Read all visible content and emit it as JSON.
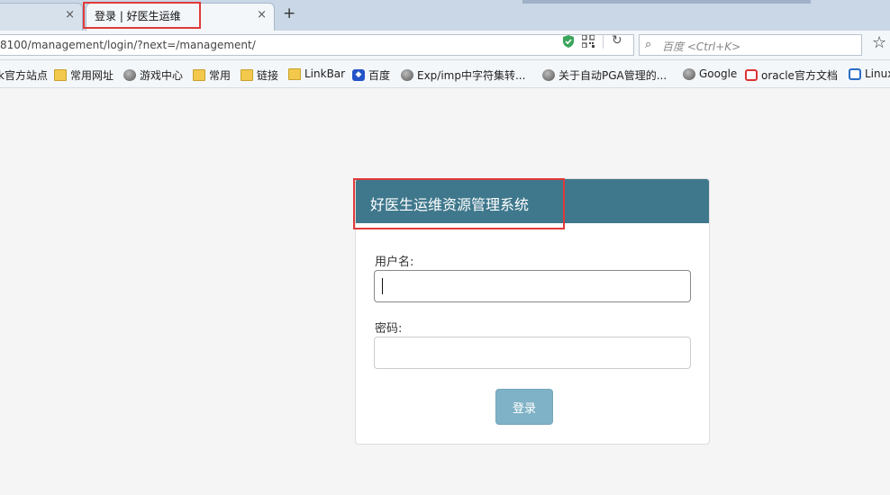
{
  "browser": {
    "tabs": [
      {
        "title": ""
      },
      {
        "title": "登录 | 好医生运维"
      }
    ],
    "tab_close_glyph": "×",
    "new_tab_glyph": "+",
    "url": "8100/management/login/?next=/management/",
    "search_placeholder": "百度 <Ctrl+K>",
    "bookmarks": [
      {
        "label": "k官方站点",
        "icon": "none"
      },
      {
        "label": "常用网址",
        "icon": "folder-icon"
      },
      {
        "label": "游戏中心",
        "icon": "globe-icon"
      },
      {
        "label": "常用",
        "icon": "folder-icon"
      },
      {
        "label": "链接",
        "icon": "folder-icon"
      },
      {
        "label": "LinkBar",
        "icon": "folder-icon"
      },
      {
        "label": "百度",
        "icon": "baidu-icon"
      },
      {
        "label": "Exp/imp中字符集转...",
        "icon": "globe-icon"
      },
      {
        "label": "关于自动PGA管理的...",
        "icon": "globe-icon"
      },
      {
        "label": "Google",
        "icon": "globe-icon"
      },
      {
        "label": "oracle官方文档",
        "icon": "google-icon"
      },
      {
        "label": "Linux",
        "icon": "linux-icon"
      }
    ]
  },
  "login": {
    "title": "好医生运维资源管理系统",
    "username_label": "用户名:",
    "password_label": "密码:",
    "username_value": "",
    "password_value": "",
    "submit_label": "登录"
  },
  "colors": {
    "panel_heading": "#3f788c",
    "button": "#7fb2c6",
    "highlight": "#e03a3a"
  }
}
